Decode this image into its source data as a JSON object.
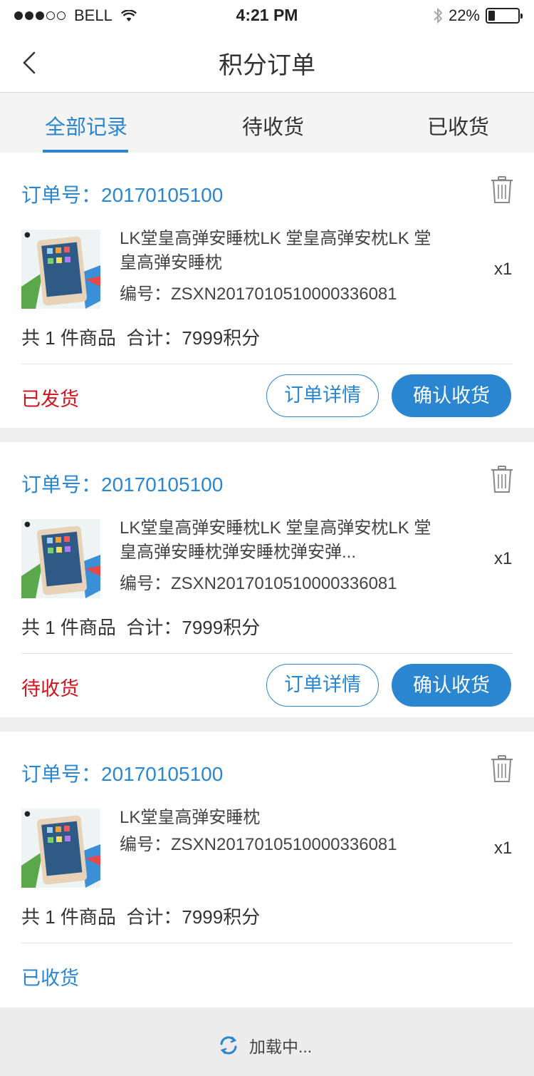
{
  "status_bar": {
    "carrier": "BELL",
    "time": "4:21 PM",
    "battery_percent": "22%",
    "battery_level": 0.22
  },
  "nav": {
    "title": "积分订单",
    "back_icon": "chevron-left-icon"
  },
  "tabs": [
    {
      "label": "全部记录",
      "active": true
    },
    {
      "label": "待收货",
      "active": false
    },
    {
      "label": "已收货",
      "active": false
    }
  ],
  "orders": [
    {
      "order_no": "订单号：20170105100",
      "name": "LK堂皇高弹安睡枕LK 堂皇高弹安枕LK 堂皇高弹安睡枕",
      "code": "编号：ZSXN2017010510000336081",
      "qty": "x1",
      "summary": "共 1 件商品  合计：7999积分",
      "status": "已发货",
      "detail_btn": "订单详情",
      "confirm_btn": "确认收货"
    },
    {
      "order_no": "订单号：20170105100",
      "name": "LK堂皇高弹安睡枕LK 堂皇高弹安枕LK 堂皇高弹安睡枕弹安睡枕弹安弹...",
      "code": "编号：ZSXN2017010510000336081",
      "qty": "x1",
      "summary": "共 1 件商品  合计：7999积分",
      "status": "待收货",
      "detail_btn": "订单详情",
      "confirm_btn": "确认收货"
    },
    {
      "order_no": "订单号：20170105100",
      "name": "LK堂皇高弹安睡枕",
      "code": "编号：ZSXN2017010510000336081",
      "qty": "x1",
      "summary": "共 1 件商品  合计：7999积分",
      "status": "已收货"
    }
  ],
  "loading_text": "加载中...",
  "colors": {
    "accent": "#2a86d1",
    "status_red": "#d0141c",
    "background": "#efefef"
  }
}
